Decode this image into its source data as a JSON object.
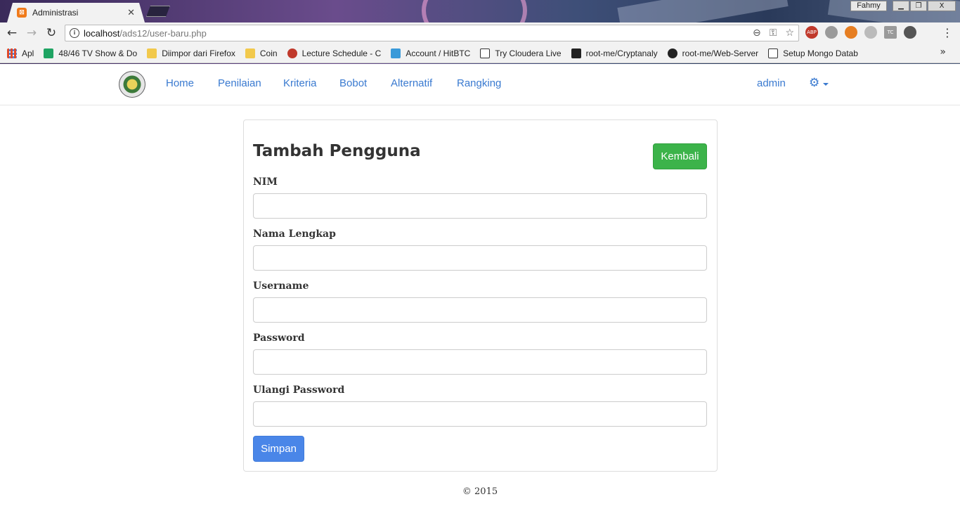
{
  "browser": {
    "tab_title": "Administrasi",
    "tab_favicon": "xampp-icon",
    "window_user": "Fahmy",
    "window_controls": {
      "minimize": "▁",
      "restore": "❐",
      "close": "X"
    },
    "url_host": "localhost",
    "url_path": "/ads12/user-baru.php",
    "bookmarks": [
      {
        "label": "Apl",
        "icon": "apps-grid-icon",
        "color": "#e04a2a"
      },
      {
        "label": "48/46 TV Show & Do",
        "icon": "sheets-icon",
        "color": "#1fa463"
      },
      {
        "label": "Diimpor dari Firefox",
        "icon": "folder-icon",
        "color": "#f2c94c"
      },
      {
        "label": "Coin",
        "icon": "folder-icon",
        "color": "#f2c94c"
      },
      {
        "label": "Lecture Schedule - C",
        "icon": "apple-icon",
        "color": "#c0392b"
      },
      {
        "label": "Account / HitBTC",
        "icon": "hitbtc-icon",
        "color": "#3a9ad9"
      },
      {
        "label": "Try Cloudera Live",
        "icon": "page-icon",
        "color": "#ffffff"
      },
      {
        "label": "root-me/Cryptanaly",
        "icon": "rootme-icon",
        "color": "#222222"
      },
      {
        "label": "root-me/Web-Server",
        "icon": "github-icon",
        "color": "#222222"
      },
      {
        "label": "Setup Mongo Datab",
        "icon": "page-icon",
        "color": "#ffffff"
      }
    ],
    "bookmarks_more": "»",
    "extensions": [
      "ABP",
      "",
      "",
      "",
      "TC",
      ""
    ]
  },
  "nav": {
    "links": [
      "Home",
      "Penilaian",
      "Kriteria",
      "Bobot",
      "Alternatif",
      "Rangking"
    ],
    "user": "admin",
    "gear_icon": "gear-icon"
  },
  "form": {
    "title": "Tambah Pengguna",
    "back_button": "Kembali",
    "fields": [
      {
        "label": "NIM",
        "value": ""
      },
      {
        "label": "Nama Lengkap",
        "value": ""
      },
      {
        "label": "Username",
        "value": ""
      },
      {
        "label": "Password",
        "value": ""
      },
      {
        "label": "Ulangi Password",
        "value": ""
      }
    ],
    "submit_button": "Simpan"
  },
  "footer": {
    "text": "© 2015"
  },
  "colors": {
    "link": "#3a7ad0",
    "success": "#3cb34a",
    "primary": "#4a86e8"
  }
}
